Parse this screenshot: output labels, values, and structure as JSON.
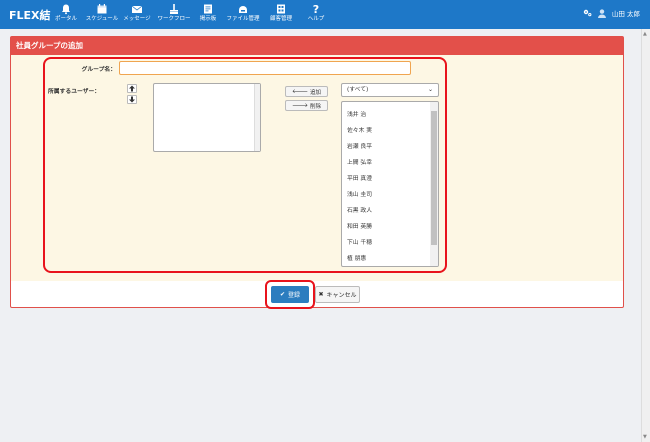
{
  "header": {
    "logo": "FLEX結",
    "nav": [
      {
        "label": "ポータル",
        "icon": "bell-icon"
      },
      {
        "label": "スケジュール",
        "icon": "calendar-icon"
      },
      {
        "label": "メッセージ",
        "icon": "envelope-icon"
      },
      {
        "label": "ワークフロー",
        "icon": "workflow-icon"
      },
      {
        "label": "掲示板",
        "icon": "bulletin-icon"
      },
      {
        "label": "ファイル管理",
        "icon": "file-icon"
      },
      {
        "label": "顧客管理",
        "icon": "customer-icon"
      },
      {
        "label": "ヘルプ",
        "icon": "help-icon"
      }
    ],
    "user_name": "山田 太郎"
  },
  "panel": {
    "title": "社員グループの追加",
    "group_name_label": "グループ名：",
    "group_name_value": "",
    "members_label": "所属するユーザー：",
    "add_label": "追加",
    "remove_label": "削除",
    "dept_selected": "(すべて)",
    "employees": [
      "浅井 治",
      "佐々木 実",
      "岩瀬 良平",
      "上間 弘幸",
      "平田 真澄",
      "浅山 圭司",
      "石黒 政人",
      "和田 英勝",
      "下山 千穂",
      "植 朋惠"
    ]
  },
  "actions": {
    "register_label": "登録",
    "cancel_label": "キャンセル"
  },
  "colors": {
    "navbar": "#1e78c8",
    "panel_header": "#e3504a",
    "form_bg": "#fdf7e4",
    "highlight": "#e8131c",
    "primary_button": "#2c7dbf"
  }
}
